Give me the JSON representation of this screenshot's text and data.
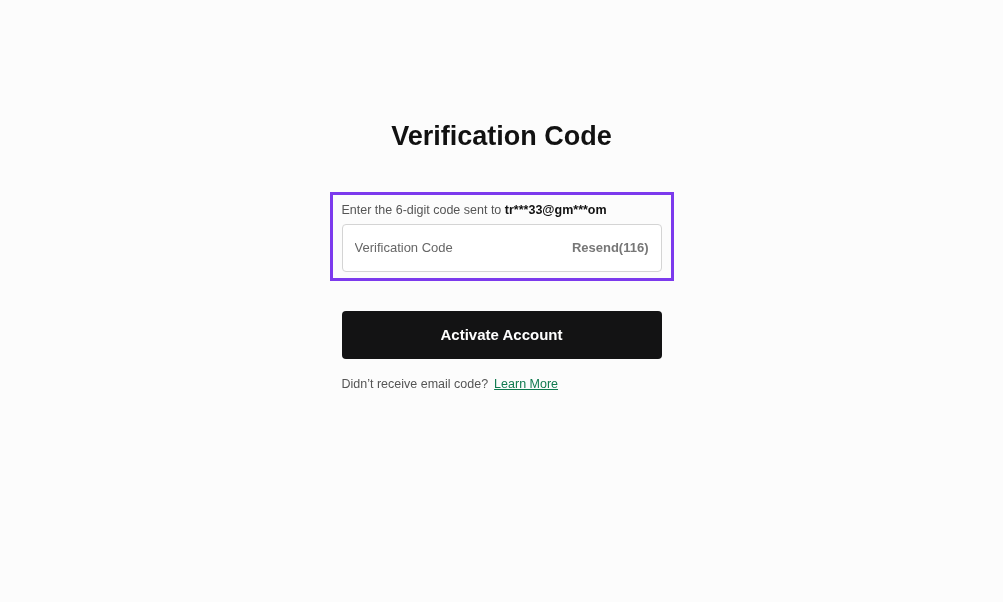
{
  "title": "Verification Code",
  "instruction": {
    "text": "Enter the 6-digit code sent to",
    "email": "tr***33@gm***om"
  },
  "code_field": {
    "placeholder": "Verification Code",
    "resend": "Resend(116)"
  },
  "highlighted": true,
  "submit_button": "Activate Account",
  "help": {
    "text": "Didn’t receive email code?",
    "link": "Learn More"
  }
}
